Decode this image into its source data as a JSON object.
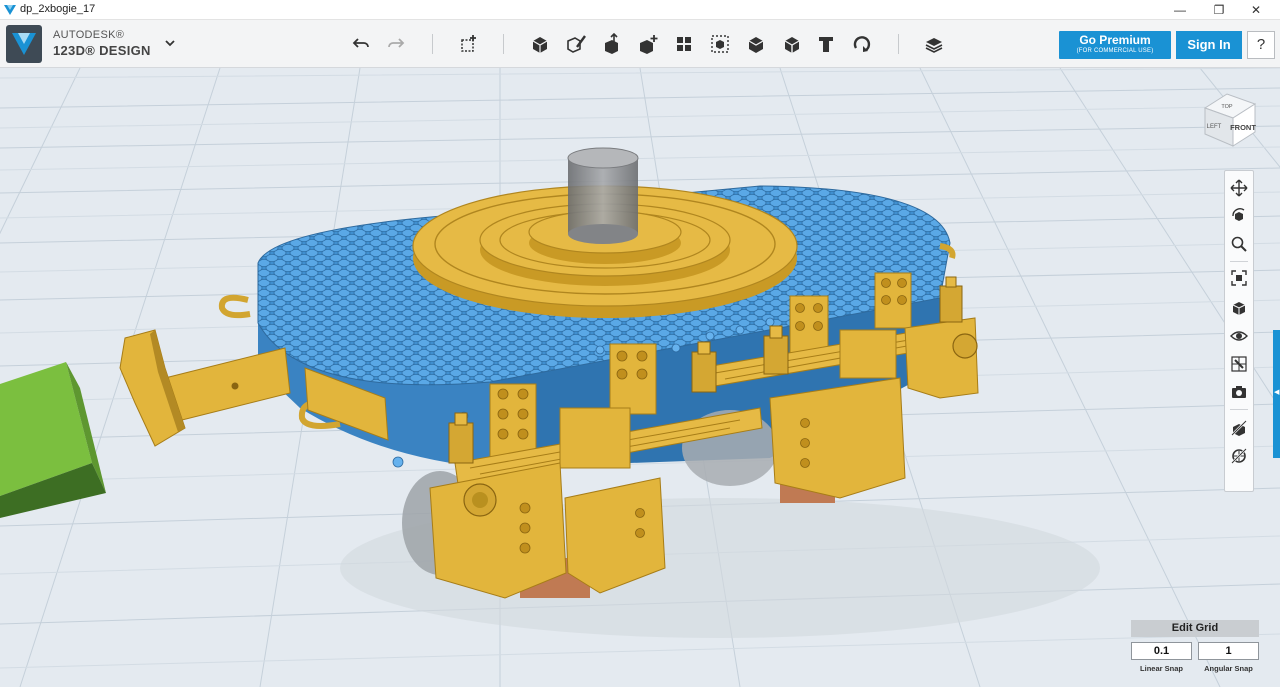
{
  "window": {
    "title": "dp_2xbogie_17",
    "min_glyph": "—",
    "max_glyph": "❐",
    "close_glyph": "✕"
  },
  "brand": {
    "line1": "AUTODESK®",
    "line2": "123D® DESIGN",
    "accent_color": "#1a92d4"
  },
  "toolbar": {
    "tools": [
      {
        "name": "undo-icon"
      },
      {
        "name": "redo-icon"
      },
      {
        "name": "transform-icon"
      },
      {
        "name": "primitives-icon"
      },
      {
        "name": "sketch-icon"
      },
      {
        "name": "construct-icon"
      },
      {
        "name": "modify-icon"
      },
      {
        "name": "pattern-icon"
      },
      {
        "name": "grouping-icon"
      },
      {
        "name": "combine-icon"
      },
      {
        "name": "measure-icon"
      },
      {
        "name": "text-icon"
      },
      {
        "name": "snap-icon"
      },
      {
        "name": "material-icon"
      }
    ],
    "premium_label": "Go Premium",
    "premium_sub": "(FOR COMMERCIAL USE)",
    "signin_label": "Sign In",
    "help_label": "?"
  },
  "viewcube": {
    "top": "TOP",
    "left": "LEFT",
    "front": "FRONT"
  },
  "navbar": {
    "items": [
      {
        "name": "pan-icon"
      },
      {
        "name": "orbit-icon"
      },
      {
        "name": "zoom-icon"
      },
      {
        "name": "fit-icon"
      },
      {
        "name": "view-mode-icon"
      },
      {
        "name": "visibility-icon"
      },
      {
        "name": "material-view-icon"
      },
      {
        "name": "snapshot-icon"
      },
      {
        "name": "hide-sketch-icon"
      },
      {
        "name": "hide-mesh-icon"
      }
    ]
  },
  "grid_panel": {
    "edit_label": "Edit Grid",
    "linear_value": "0.1",
    "angular_value": "1",
    "linear_label": "Linear Snap",
    "angular_label": "Angular Snap"
  },
  "colors": {
    "viewport_bg": "#e4eaf0",
    "grid_line": "#c5d0da",
    "model_blue": "#3f8fd0",
    "model_gold": "#e2b53c",
    "cylinder_gray": "#8d8f92",
    "block_green": "#6aa63b"
  }
}
